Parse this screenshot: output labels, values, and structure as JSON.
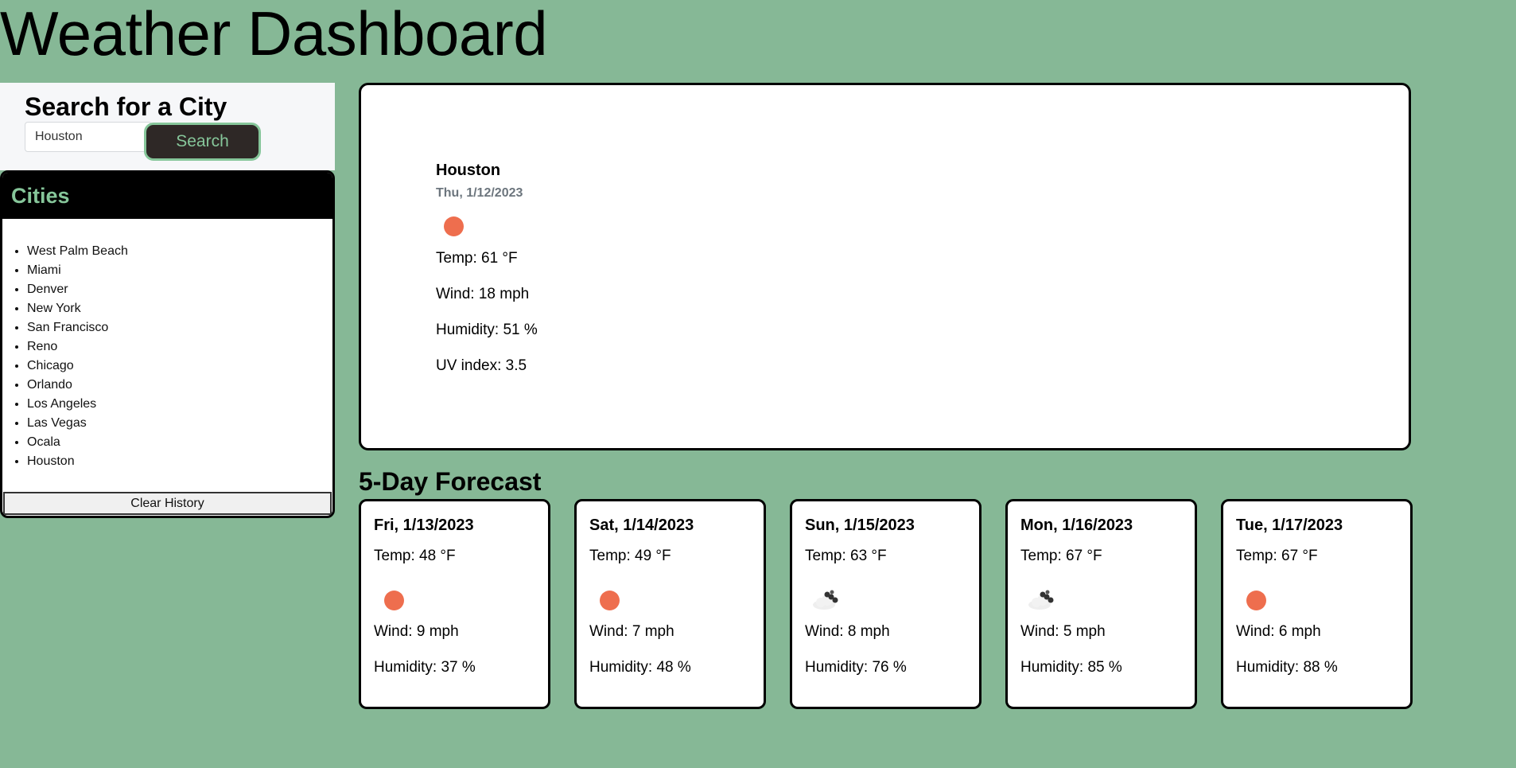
{
  "page": {
    "title": "Weather Dashboard"
  },
  "search": {
    "heading": "Search for a City",
    "input_value": "Houston",
    "button_label": "Search"
  },
  "cities": {
    "heading": "Cities",
    "items": [
      "West Palm Beach",
      "Miami",
      "Denver",
      "New York",
      "San Francisco",
      "Reno",
      "Chicago",
      "Orlando",
      "Los Angeles",
      "Las Vegas",
      "Ocala",
      "Houston"
    ],
    "clear_label": "Clear History"
  },
  "current": {
    "city": "Houston",
    "date": "Thu, 1/12/2023",
    "icon": "sun-icon",
    "temp": "Temp: 61 °F",
    "wind": "Wind: 18 mph",
    "humidity": "Humidity: 51 %",
    "uv": "UV index: 3.5"
  },
  "forecast": {
    "heading": "5-Day Forecast",
    "days": [
      {
        "date": "Fri, 1/13/2023",
        "temp": "Temp: 48 °F",
        "icon": "sun-icon",
        "wind": "Wind: 9 mph",
        "humidity": "Humidity: 37 %"
      },
      {
        "date": "Sat, 1/14/2023",
        "temp": "Temp: 49 °F",
        "icon": "sun-icon",
        "wind": "Wind: 7 mph",
        "humidity": "Humidity: 48 %"
      },
      {
        "date": "Sun, 1/15/2023",
        "temp": "Temp: 63 °F",
        "icon": "cloud-icon",
        "wind": "Wind: 8 mph",
        "humidity": "Humidity: 76 %"
      },
      {
        "date": "Mon, 1/16/2023",
        "temp": "Temp: 67 °F",
        "icon": "cloud-icon",
        "wind": "Wind: 5 mph",
        "humidity": "Humidity: 85 %"
      },
      {
        "date": "Tue, 1/17/2023",
        "temp": "Temp: 67 °F",
        "icon": "sun-icon",
        "wind": "Wind: 6 mph",
        "humidity": "Humidity: 88 %"
      }
    ]
  },
  "colors": {
    "background": "#86b896",
    "accent": "#86c69a",
    "sun": "#ee6e4e"
  }
}
